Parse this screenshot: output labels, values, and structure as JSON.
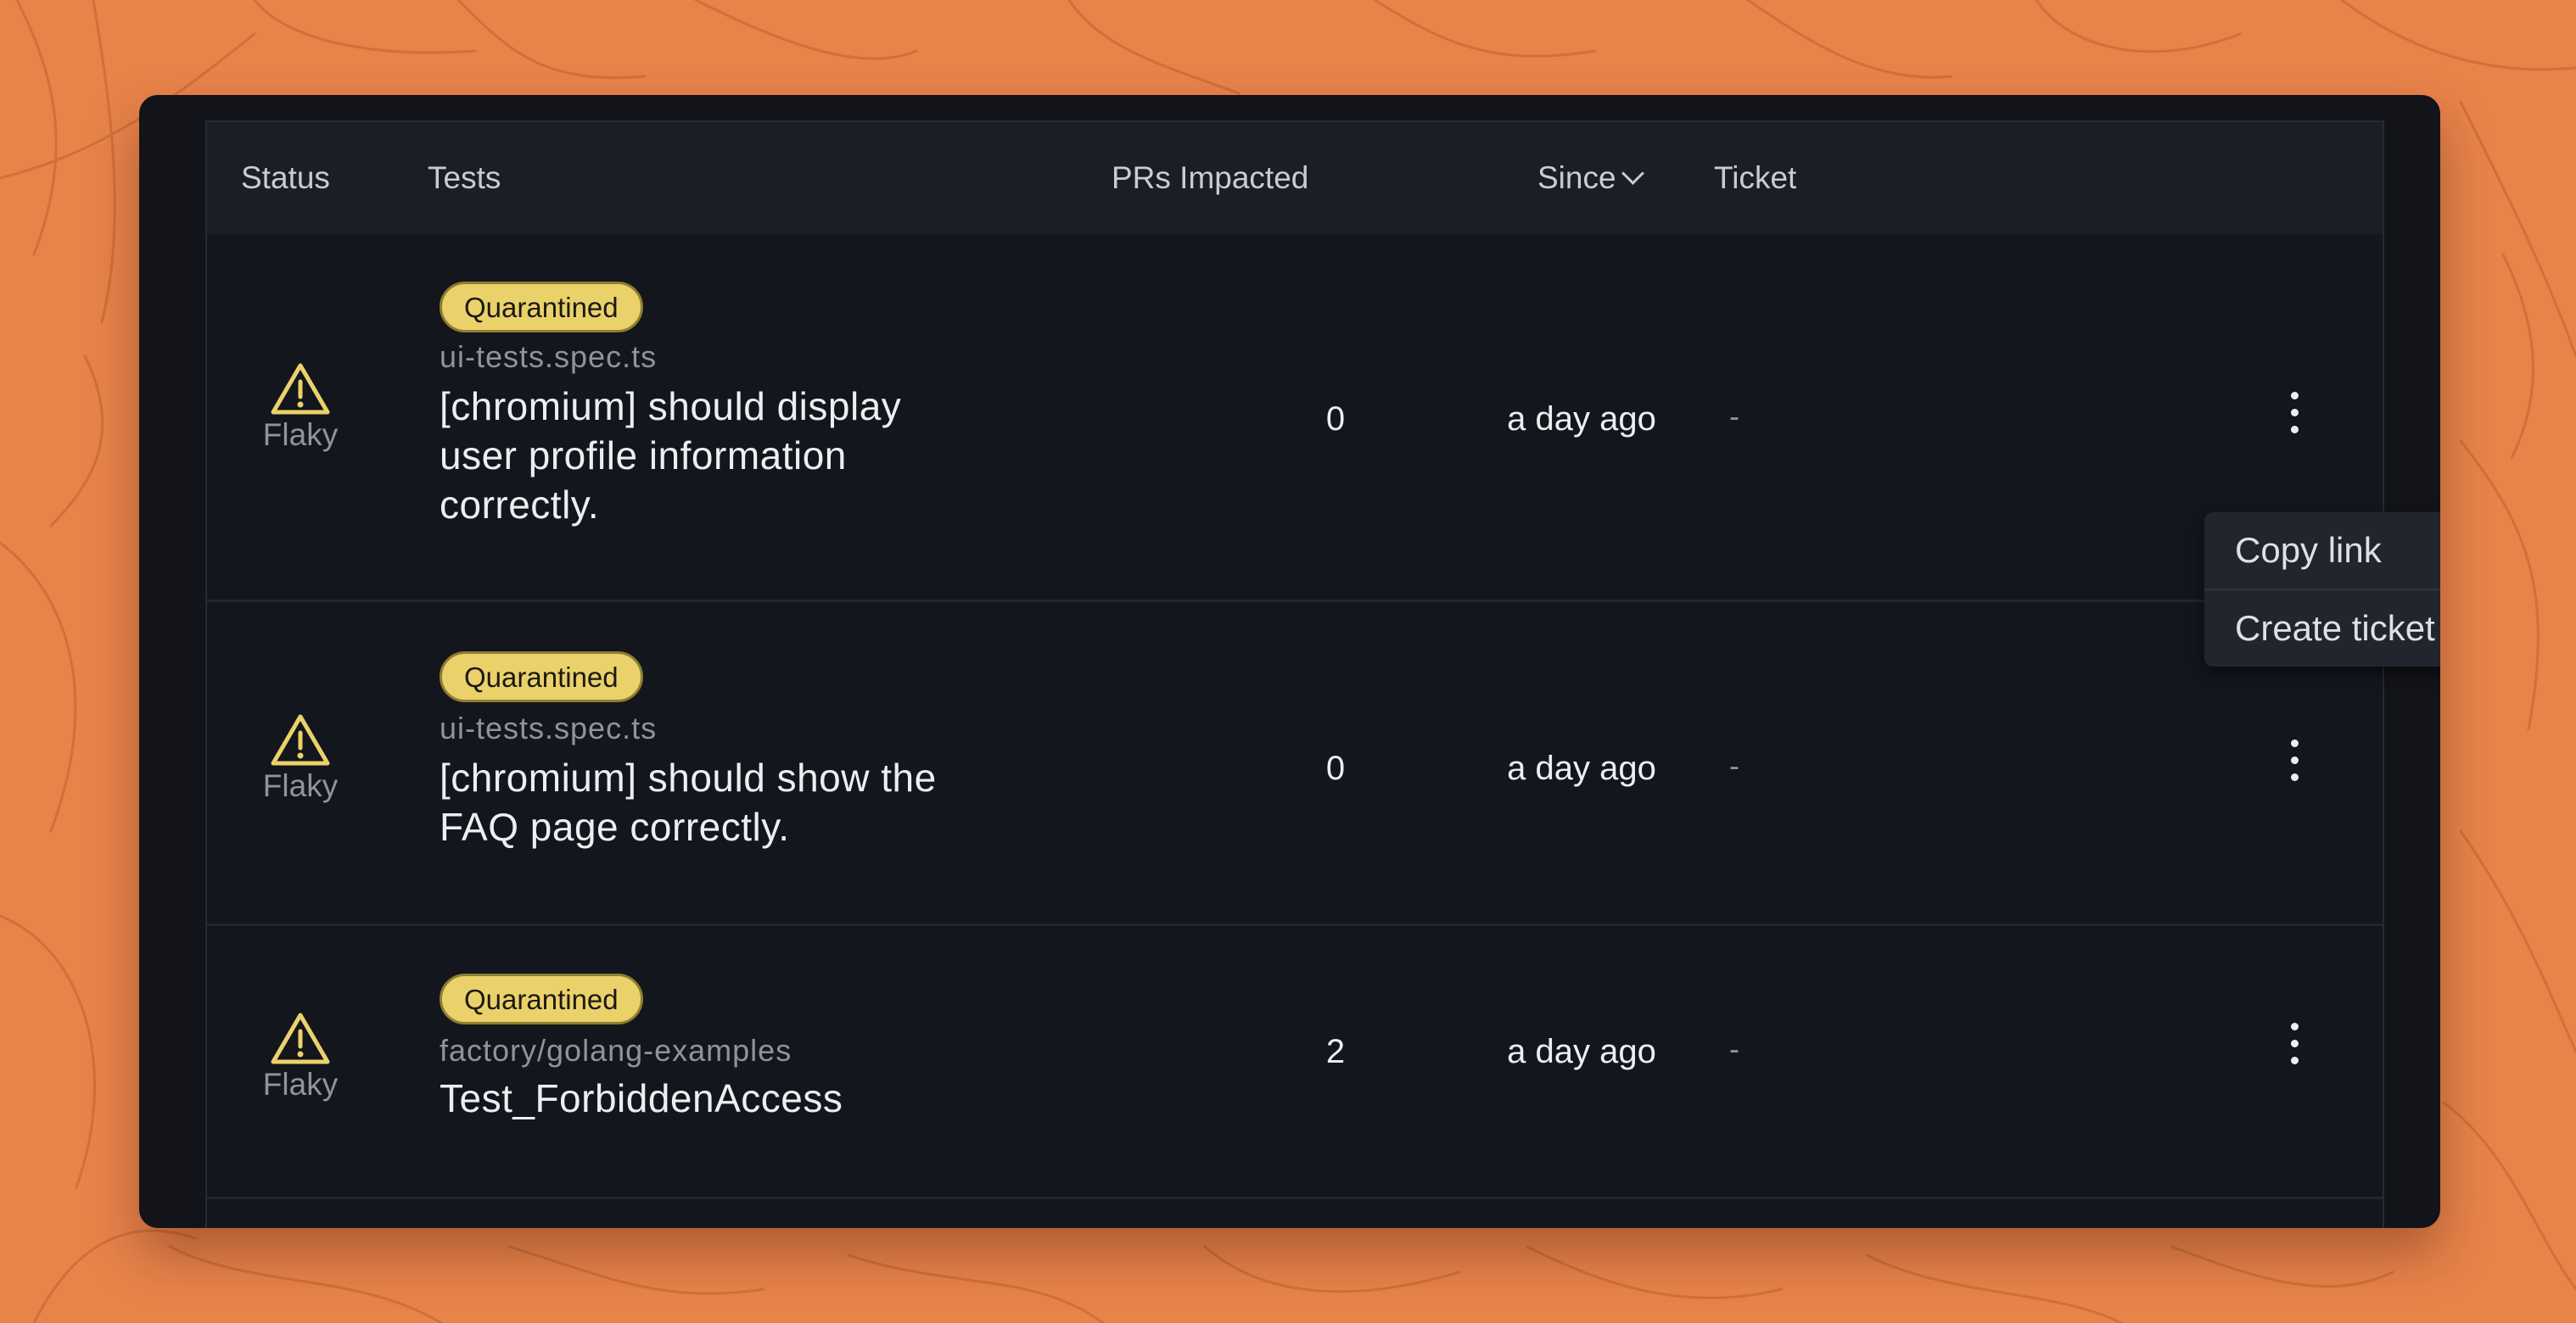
{
  "colors": {
    "background": "#e8834a",
    "window": "#12141a",
    "header": "#1b1e26",
    "badge": "#ebd16a",
    "warning_icon": "#ebd16a",
    "text_primary": "#eceef2",
    "text_muted": "#8f949c"
  },
  "table": {
    "columns": {
      "status": "Status",
      "tests": "Tests",
      "prs_impacted": "PRs Impacted",
      "since": "Since",
      "ticket": "Ticket"
    },
    "rows": [
      {
        "status_icon": "warning-icon",
        "status": "Flaky",
        "badge": "Quarantined",
        "file": "ui-tests.spec.ts",
        "test_line1": "[chromium] should display",
        "test_line2": "user profile information",
        "test_line3": "correctly.",
        "prs": "0",
        "since": "a day ago",
        "ticket": "-"
      },
      {
        "status_icon": "warning-icon",
        "status": "Flaky",
        "badge": "Quarantined",
        "file": "ui-tests.spec.ts",
        "test_line1": "[chromium] should show the",
        "test_line2": "FAQ page correctly.",
        "prs": "0",
        "since": "a day ago",
        "ticket": "-"
      },
      {
        "status_icon": "warning-icon",
        "status": "Flaky",
        "badge": "Quarantined",
        "file": "factory/golang-examples",
        "test_line1": "Test_ForbiddenAccess",
        "prs": "2",
        "since": "a day ago",
        "ticket": "-"
      }
    ]
  },
  "context_menu": {
    "items": [
      "Copy link",
      "Create ticket"
    ]
  }
}
